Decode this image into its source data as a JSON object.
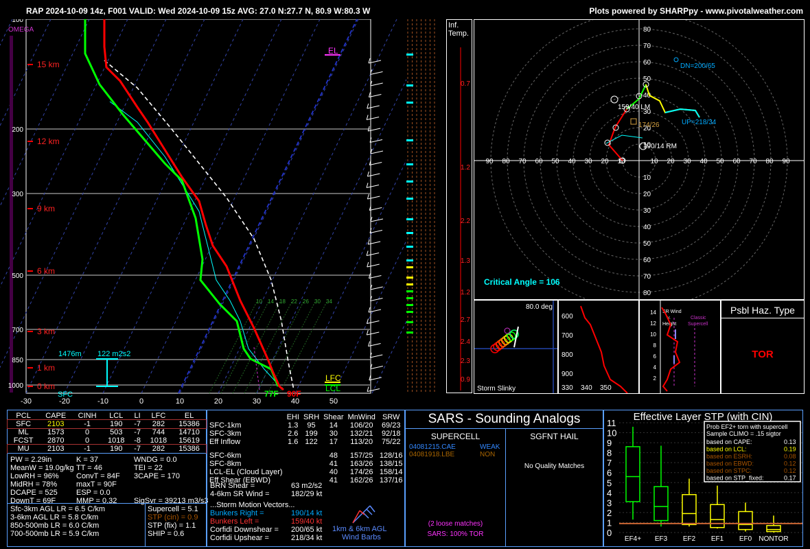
{
  "header": {
    "title": "RAP 2024-10-09 14z, F001  VALID: Wed 2024-10-09 15z  AVG: 27.0 N:27.7 N, 80.9 W:80.3 W",
    "credit": "Plots powered by SHARPpy - www.pivotalweather.com"
  },
  "skewt": {
    "omega_label": "OMEGA",
    "pressure_labels": [
      "100",
      "200",
      "300",
      "500",
      "700",
      "850",
      "1000"
    ],
    "height_labels": [
      "15 km",
      "12 km",
      "9 km",
      "6 km",
      "3 km",
      "1 km",
      "0 km"
    ],
    "temp_ticks": [
      "-30",
      "-20",
      "-10",
      "0",
      "10",
      "20",
      "30",
      "40",
      "50"
    ],
    "el_label": "EL",
    "lfc_label": "LFC",
    "lcl_label": "LCL",
    "sfc_label": "SFC",
    "sfc_td": "77F",
    "sfc_t": "90F",
    "eff_layer_depth": "1476m",
    "eff_layer_srh": "122 m2s2",
    "mixing_ratio_labels": [
      "10",
      "14",
      "18",
      "22",
      "26",
      "30",
      "34"
    ]
  },
  "inflow": {
    "label1": "Inf.",
    "label2": "Temp.",
    "values": [
      "0.7",
      "1.2",
      "2.2",
      "1.3",
      "1.2",
      "2.7",
      "2.4",
      "2.3",
      "0.9"
    ]
  },
  "hodograph": {
    "critical_angle": "Critical Angle = 106",
    "dn_label": "DN=200/65",
    "up_label": "UP=218/34",
    "lm_label": "159/40 LM",
    "rm_label": "190/14 RM",
    "mean_label": "174/26",
    "ring_labels": [
      "80",
      "70",
      "60",
      "50",
      "40",
      "30",
      "20",
      "10"
    ],
    "axis_labels": [
      "90",
      "80",
      "70",
      "60",
      "50",
      "40",
      "30",
      "20",
      "10",
      "10",
      "20",
      "30",
      "40",
      "50",
      "60",
      "70",
      "80",
      "90"
    ]
  },
  "slinky": {
    "label": "Storm Slinky",
    "deg": "80.0 deg"
  },
  "theta": {
    "y_labels": [
      "600",
      "700",
      "800",
      "900"
    ],
    "x_labels": [
      "330",
      "340",
      "350"
    ]
  },
  "srwind": {
    "title1": "SR Wind",
    "title2": "v.",
    "title3": "Height",
    "classic1": "Classic",
    "classic2": "Supercell",
    "y_labels": [
      "14",
      "12",
      "10",
      "8",
      "6",
      "4",
      "2"
    ]
  },
  "haz": {
    "title": "Psbl Haz. Type",
    "value": "TOR"
  },
  "parcels": {
    "headers": [
      "PCL",
      "CAPE",
      "CINH",
      "LCL",
      "LI",
      "LFC",
      "EL"
    ],
    "rows": [
      [
        "SFC",
        "2103",
        "-1",
        "190",
        "-7",
        "282",
        "15386"
      ],
      [
        "ML",
        "1573",
        "0",
        "503",
        "-7",
        "744",
        "14710"
      ],
      [
        "FCST",
        "2870",
        "0",
        "1018",
        "-8",
        "1018",
        "15619"
      ],
      [
        "MU",
        "2103",
        "-1",
        "190",
        "-7",
        "282",
        "15386"
      ]
    ]
  },
  "indices": [
    [
      "PW = 2.29in",
      "K = 37",
      "WNDG = 0.0"
    ],
    [
      "MeanW = 19.0g/kg",
      "TT = 46",
      "TEI = 22"
    ],
    [
      "LowRH = 96%",
      "ConvT = 84F",
      "3CAPE = 170"
    ],
    [
      "MidRH = 78%",
      "maxT = 90F",
      ""
    ],
    [
      "DCAPE = 525",
      "ESP = 0.0",
      ""
    ],
    [
      "DownT = 69F",
      "MMP = 0.32",
      "SigSvr = 39213 m3/s3"
    ]
  ],
  "lapse": [
    "Sfc-3km AGL LR = 6.5 C/km",
    "3-6km AGL LR = 5.8 C/km",
    "850-500mb LR = 6.0 C/km",
    "700-500mb LR = 5.9 C/km"
  ],
  "composite": [
    "Supercell = 5.1",
    "STP (cin) = 0.9",
    "STP (fix) = 1.1",
    "SHIP = 0.6"
  ],
  "kinematics": {
    "headers": [
      "",
      "EHI",
      "SRH",
      "Shear",
      "MnWind",
      "SRW"
    ],
    "rows": [
      [
        "SFC-1km",
        "1.3",
        "95",
        "14",
        "106/20",
        "69/23"
      ],
      [
        "SFC-3km",
        "2.6",
        "199",
        "30",
        "132/21",
        "92/18"
      ],
      [
        "Eff Inflow",
        "1.6",
        "122",
        "17",
        "113/20",
        "75/22"
      ],
      [
        "",
        "",
        "",
        "",
        "",
        ""
      ],
      [
        "SFC-6km",
        "",
        "",
        "48",
        "157/25",
        "128/16"
      ],
      [
        "SFC-8km",
        "",
        "",
        "41",
        "163/26",
        "138/15"
      ],
      [
        "LCL-EL (Cloud Layer)",
        "",
        "",
        "40",
        "174/26",
        "158/14"
      ],
      [
        "Eff Shear (EBWD)",
        "",
        "",
        "41",
        "162/26",
        "137/16"
      ]
    ],
    "brn_shear": [
      "BRN Shear =",
      "63 m2/s2"
    ],
    "sr_wind": [
      "4-6km SR Wind =",
      "182/29 kt"
    ],
    "motion_title": "...Storm Motion Vectors...",
    "motions": [
      [
        "Bunkers Right =",
        "190/14 kt"
      ],
      [
        "Bunkers Left =",
        "159/40 kt"
      ],
      [
        "Corfidi Downshear =",
        "200/65 kt"
      ],
      [
        "Corfidi Upshear =",
        "218/34 kt"
      ]
    ],
    "barb_label1": "1km & 6km AGL",
    "barb_label2": "Wind Barbs"
  },
  "sars": {
    "title": "SARS - Sounding Analogs",
    "supercell_title": "SUPERCELL",
    "hail_title": "SGFNT HAIL",
    "matches": [
      [
        "04081215.CAE",
        "WEAK"
      ],
      [
        "04081918.LBE",
        "NON"
      ]
    ],
    "hail_text": "No Quality Matches",
    "loose": "(2 loose matches)",
    "tor": "SARS: 100% TOR"
  },
  "stp": {
    "title": "Effective Layer STP (with CIN)",
    "legend_title1": "Prob EF2+ torn with supercell",
    "legend_title2": "Sample CLIMO = .15 sigtor",
    "legend": [
      [
        "based on CAPE:",
        "0.13"
      ],
      [
        "based on LCL:",
        "0.19"
      ],
      [
        "based on ESRH:",
        "0.08"
      ],
      [
        "based on EBWD:",
        "0.12"
      ],
      [
        "based on STPC:",
        "0.12"
      ],
      [
        "based on STP_fixed:",
        "0.17"
      ]
    ],
    "y_labels": [
      "0",
      "1",
      "2",
      "3",
      "4",
      "5",
      "6",
      "7",
      "8",
      "9",
      "10",
      "11"
    ],
    "categories": [
      "EF4+",
      "EF3",
      "EF2",
      "EF1",
      "EF0",
      "NONTOR"
    ]
  },
  "chart_data": {
    "type": "box",
    "title": "Effective Layer STP (with CIN)",
    "categories": [
      "EF4+",
      "EF3",
      "EF2",
      "EF1",
      "EF0",
      "NONTOR"
    ],
    "series": [
      {
        "whisker_low": [
          1.3,
          0.6,
          0.6,
          0.4,
          0.1,
          0.0
        ],
        "q1": [
          3.1,
          1.2,
          0.8,
          0.5,
          0.3,
          0.1
        ],
        "median": [
          5.6,
          2.6,
          1.9,
          1.3,
          0.8,
          0.3
        ],
        "q3": [
          8.6,
          4.6,
          3.8,
          2.8,
          2.1,
          0.7
        ],
        "whisker_high": [
          10.6,
          8.7,
          5.4,
          4.7,
          3.0,
          1.7
        ]
      }
    ],
    "current_value": 0.9,
    "ylim": [
      0,
      11
    ]
  },
  "colors": {
    "temp": "#ff0000",
    "dew": "#00ff00",
    "parcel": "#ffffff",
    "virtual": "#00ffff",
    "panel_border": "#5aa0ff"
  }
}
